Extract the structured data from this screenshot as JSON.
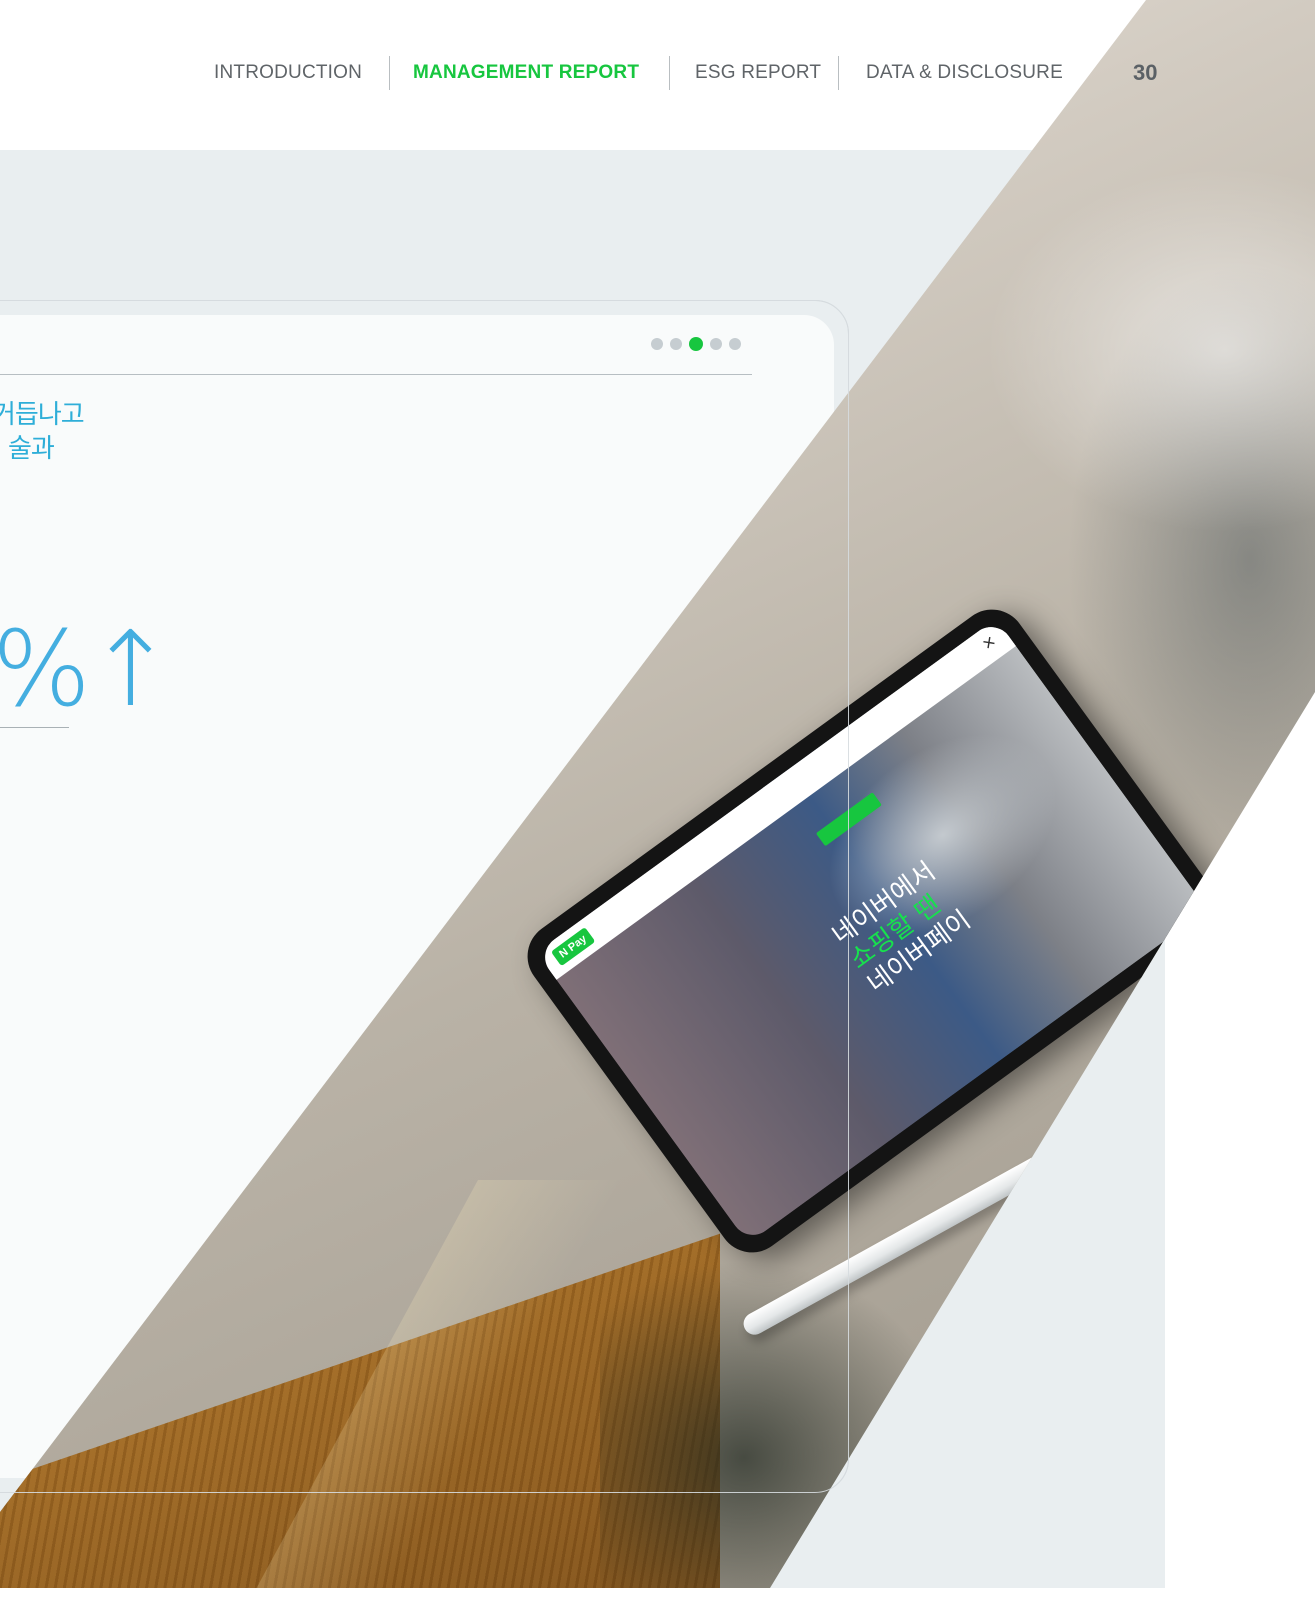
{
  "nav": {
    "items": [
      {
        "label": "INTRODUCTION"
      },
      {
        "label": "MANAGEMENT REPORT"
      },
      {
        "label": "ESG REPORT"
      },
      {
        "label": "DATA & DISCLOSURE"
      }
    ],
    "active": "MANAGEMENT REPORT",
    "page_number": "30"
  },
  "card": {
    "pager": {
      "total": 5,
      "active_index": 3
    },
    "headline_line1": "거듭나고",
    "headline_line2": "술과",
    "stat_text": "%↑"
  },
  "photo": {
    "tablet": {
      "logo": "N Pay",
      "close": "×",
      "text_line1": "네이버에서",
      "text_line2": "쇼핑할 땐",
      "text_line3": "네이버페이"
    }
  },
  "colors": {
    "accent_green": "#17c63f",
    "headline_blue": "#2eaed8",
    "band_grey": "#e9eef0"
  }
}
